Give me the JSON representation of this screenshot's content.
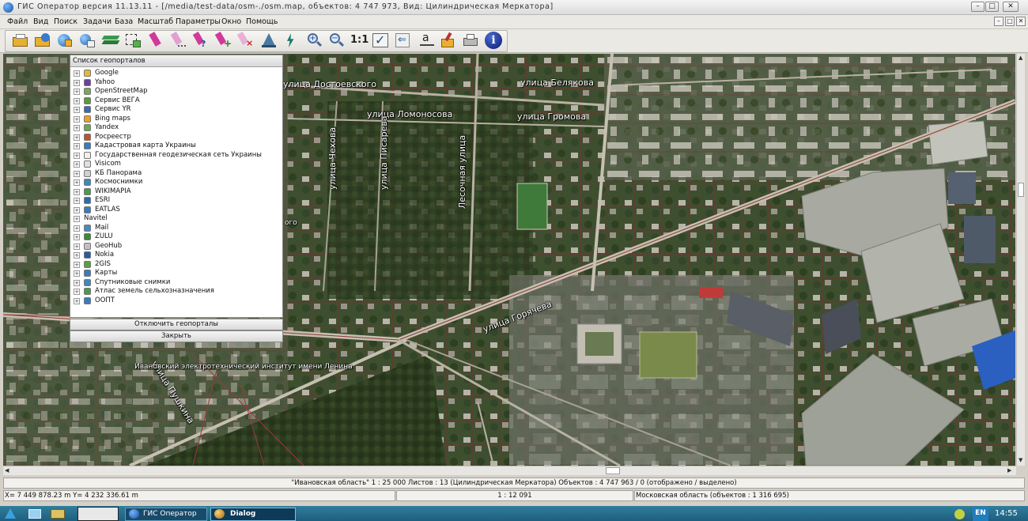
{
  "window": {
    "title": "ГИС Оператор версия 11.13.11 - [/media/test-data/osm-./osm.map, объектов: 4 747 973, Вид: Цилиндрическая Меркатора]",
    "minimize_label": "–",
    "maximize_label": "□",
    "close_label": "✕"
  },
  "menu": {
    "items": [
      "Файл",
      "Вид",
      "Поиск",
      "Задачи",
      "База",
      "Масштаб",
      "Параметры",
      "Окно",
      "Помощь"
    ]
  },
  "toolbar": {
    "scale_label": "1:1",
    "icons": [
      "open-file-icon",
      "open-folder-icon",
      "open-map-icon",
      "open-layers-icon",
      "layers-icon",
      "select-add-icon",
      "marker-icon",
      "marker-dots-icon",
      "marker-question-icon",
      "marker-add-icon",
      "marker-remove-icon",
      "map-tree-icon",
      "lightning-icon",
      "zoom-in-icon",
      "zoom-out-icon",
      "scale-1-1-icon",
      "check-icon",
      "back-arrow-icon",
      "text-icon",
      "paint-icon",
      "print-icon",
      "info-icon"
    ]
  },
  "map": {
    "streets": [
      "улица Достоевского",
      "улица Белякова",
      "улица Ломоносова",
      "улица Громова",
      "улица Чехова",
      "улица Писарева",
      "Лесочная улица",
      "улица Горячева",
      "улица Пушкина",
      "Ивановский электротехнический институт имени Ленина"
    ],
    "street_fragment": "ого"
  },
  "geoportals": {
    "header": "Список геопорталов",
    "items": [
      {
        "label": "Google",
        "icon": "google-icon",
        "color": "#e8b830",
        "has_icon": true
      },
      {
        "label": "Yahoo",
        "icon": "yahoo-icon",
        "color": "#6b3fa0",
        "has_icon": true
      },
      {
        "label": "OpenStreetMap",
        "icon": "osm-icon",
        "color": "#7aa860",
        "has_icon": true
      },
      {
        "label": "Сервис ВЕГА",
        "icon": "vega-icon",
        "color": "#5a9a3a",
        "has_icon": true
      },
      {
        "label": "Сервис YR",
        "icon": "yr-icon",
        "color": "#3a6ab0",
        "has_icon": true
      },
      {
        "label": "Bing maps",
        "icon": "bing-icon",
        "color": "#f0a020",
        "has_icon": true
      },
      {
        "label": "Yandex",
        "icon": "yandex-icon",
        "color": "#6aa84f",
        "has_icon": true
      },
      {
        "label": "Росреестр",
        "icon": "rosreestr-icon",
        "color": "#c05030",
        "has_icon": true
      },
      {
        "label": "Кадастровая карта Украины",
        "icon": "ukraine-cadastre-icon",
        "color": "#3a7ac0",
        "has_icon": true
      },
      {
        "label": "Государственная геодезическая сеть Украины",
        "icon": "ukraine-geodetic-icon",
        "color": "#f0f0f0",
        "has_icon": true
      },
      {
        "label": "Visicom",
        "icon": "visicom-icon",
        "color": "#e0e0e0",
        "has_icon": true
      },
      {
        "label": "КБ Панорама",
        "icon": "panorama-icon",
        "color": "#d0d0d0",
        "has_icon": true
      },
      {
        "label": "Космоснимки",
        "icon": "kosmosnimki-icon",
        "color": "#3a8ac0",
        "has_icon": true
      },
      {
        "label": "WIKIMAPIA",
        "icon": "wikimapia-icon",
        "color": "#4a9a4a",
        "has_icon": true
      },
      {
        "label": "ESRI",
        "icon": "esri-icon",
        "color": "#2a6ab0",
        "has_icon": true
      },
      {
        "label": "EATLAS",
        "icon": "eatlas-icon",
        "color": "#3a7ac0",
        "has_icon": true
      },
      {
        "label": "Navitel",
        "icon": "",
        "color": "",
        "has_icon": false
      },
      {
        "label": "Mail",
        "icon": "mail-icon",
        "color": "#4a8ac0",
        "has_icon": true
      },
      {
        "label": "ZULU",
        "icon": "zulu-icon",
        "color": "#3a8a3a",
        "has_icon": true
      },
      {
        "label": "GeoHub",
        "icon": "geohub-icon",
        "color": "#c0c0c0",
        "has_icon": true
      },
      {
        "label": "Nokia",
        "icon": "nokia-icon",
        "color": "#2a5aa0",
        "has_icon": true
      },
      {
        "label": "2GIS",
        "icon": "2gis-icon",
        "color": "#5aa040",
        "has_icon": true
      },
      {
        "label": "Карты",
        "icon": "maps-icon",
        "color": "#3a7ac0",
        "has_icon": true
      },
      {
        "label": "Спутниковые снимки",
        "icon": "satellite-icon",
        "color": "#3a8ac0",
        "has_icon": true
      },
      {
        "label": "Атлас земель сельхозназначения",
        "icon": "atlas-icon",
        "color": "#4a9a4a",
        "has_icon": true
      },
      {
        "label": "ООПТ",
        "icon": "oopt-icon",
        "color": "#3a7ac0",
        "has_icon": true
      }
    ],
    "disable_button": "Отключить геопорталы",
    "close_button": "Закрыть"
  },
  "status": {
    "info": "\"Ивановская область\" 1 : 25 000   Листов : 13  (Цилиндрическая Меркатора)  Объектов : 4 747 963 / 0 (отображено / выделено)",
    "coordinates": "X= 7 449 878.23 m     Y= 4 232 336.61 m",
    "scale": "1 : 12 091",
    "layer": "Московская область  (объектов : 1 316 695)"
  },
  "taskbar": {
    "tasks": [
      "ГИС Оператор",
      "Dialog"
    ],
    "language": "EN",
    "time": "14:55"
  }
}
